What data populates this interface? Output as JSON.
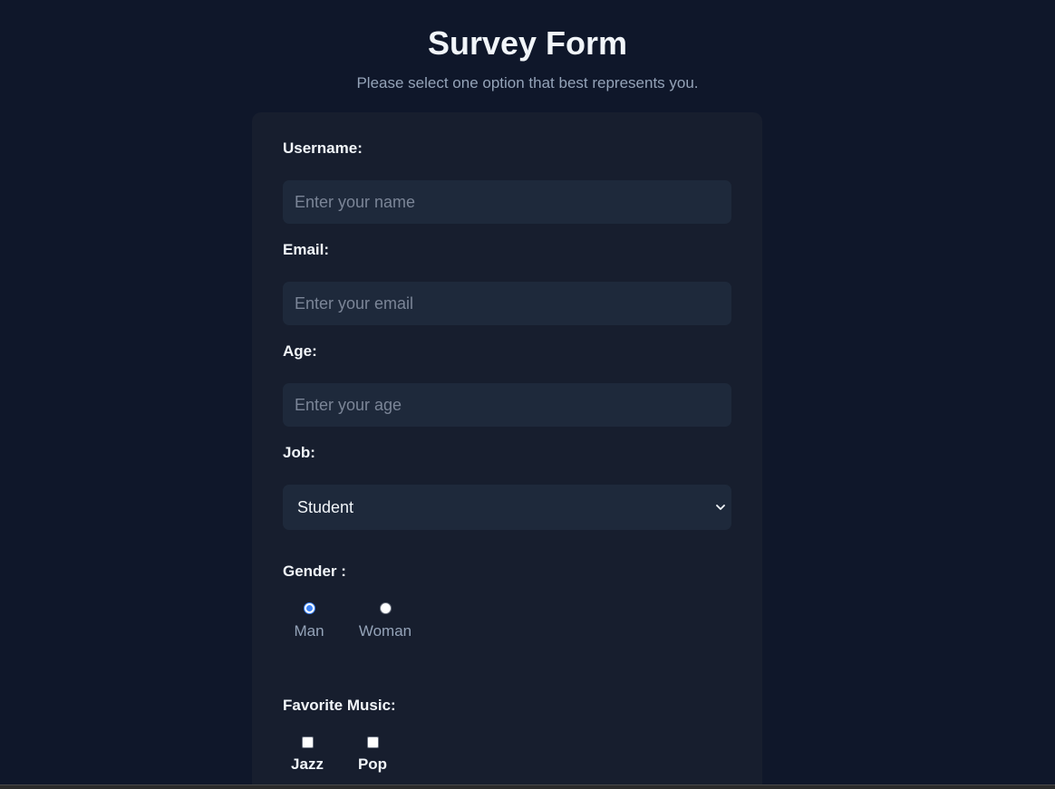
{
  "header": {
    "title": "Survey Form",
    "subtitle": "Please select one option that best represents you."
  },
  "form": {
    "username": {
      "label": "Username:",
      "placeholder": "Enter your name",
      "value": ""
    },
    "email": {
      "label": "Email:",
      "placeholder": "Enter your email",
      "value": ""
    },
    "age": {
      "label": "Age:",
      "placeholder": "Enter your age",
      "value": ""
    },
    "job": {
      "label": "Job:",
      "selected": "Student",
      "icon": "chevron-down-icon"
    },
    "gender": {
      "label": "Gender :",
      "options": [
        {
          "label": "Man",
          "checked": true
        },
        {
          "label": "Woman",
          "checked": false
        }
      ]
    },
    "music": {
      "label": "Favorite Music:",
      "options": [
        {
          "label": "Jazz",
          "checked": false
        },
        {
          "label": "Pop",
          "checked": false
        }
      ]
    }
  },
  "colors": {
    "background": "#0f172a",
    "card": "#171e2e",
    "input": "#1e293b",
    "accent": "#3b82f6",
    "text": "#f1f5f9",
    "muted": "#94a3b8"
  }
}
